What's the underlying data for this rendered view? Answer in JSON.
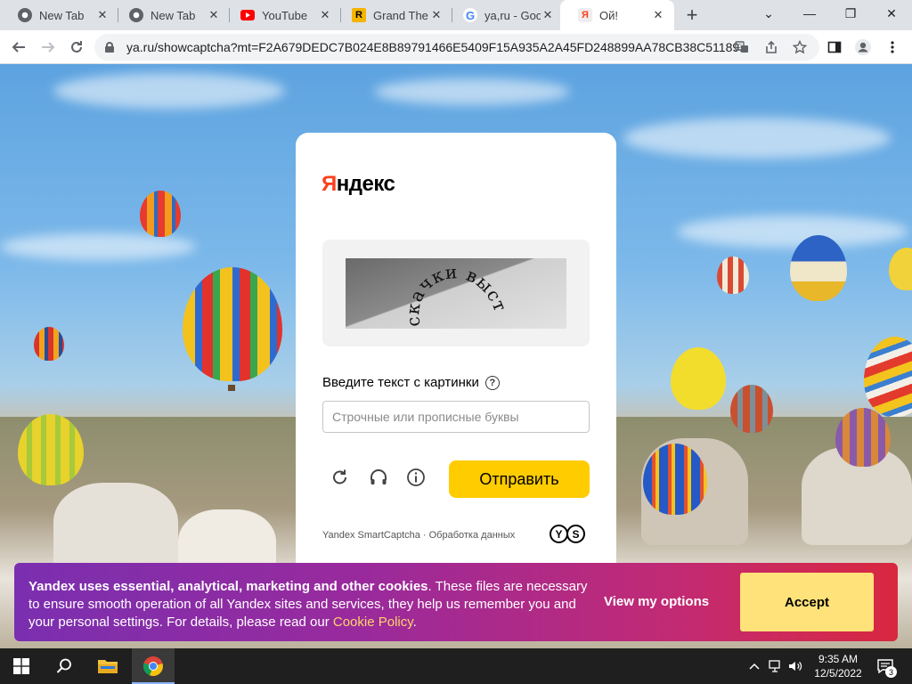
{
  "browser": {
    "tabs": [
      {
        "title": "New Tab",
        "favicon": "chrome-icon"
      },
      {
        "title": "New Tab",
        "favicon": "chrome-icon"
      },
      {
        "title": "YouTube",
        "favicon": "youtube-icon"
      },
      {
        "title": "Grand The",
        "favicon": "gta-icon"
      },
      {
        "title": "ya,ru - Goo",
        "favicon": "google-icon"
      },
      {
        "title": "Ой!",
        "favicon": "yandex-icon",
        "active": true
      }
    ],
    "tab_close_glyph": "✕",
    "new_tab_glyph": "+",
    "address": "ya.ru/showcaptcha?mt=F2A679DEDC7B024E8B89791466E5409F15A935A2A45FD248899AA78CB38C51189...",
    "window_controls": {
      "dropdown": "⌄",
      "minimize": "—",
      "restore": "❐",
      "close": "✕"
    }
  },
  "yandex": {
    "logo_first": "Я",
    "logo_rest": "ндекс",
    "captcha_text": "скачки выстала",
    "prompt": "Введите текст с картинки",
    "input_value": "",
    "input_placeholder": "Строчные или прописные буквы",
    "submit_label": "Отправить",
    "footer": "Yandex SmartCaptcha · Обработка данных",
    "footer_logo": [
      "Y",
      "S"
    ]
  },
  "cookie_banner": {
    "bold_text": "Yandex uses essential, analytical, marketing and other cookies",
    "text": ". These files are necessary to ensure smooth operation of all Yandex sites and services, they help us remember you and your personal settings. For details, please read our ",
    "link_text": "Cookie Policy",
    "trailing": ".",
    "view_options_label": "View my options",
    "accept_label": "Accept"
  },
  "taskbar": {
    "time": "9:35 AM",
    "date": "12/5/2022",
    "notification_count": "3",
    "pinned": [
      "windows-start-icon",
      "search-icon",
      "file-explorer-icon",
      "chrome-icon"
    ]
  },
  "colors": {
    "yandex_red": "#fc3f1d",
    "submit_yellow": "#ffcc00",
    "accept_yellow": "#ffe27a",
    "cookie_gradient_start": "#7a2fb0",
    "cookie_gradient_end": "#d8283f"
  }
}
